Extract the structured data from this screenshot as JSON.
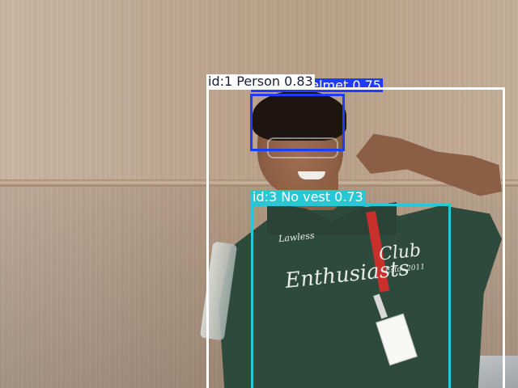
{
  "detections": [
    {
      "id": 1,
      "label": "Person",
      "confidence": "0.83",
      "text": "id:1 Person 0.83",
      "color": "#ffffff",
      "text_color": "#1c1c3a"
    },
    {
      "id": 2,
      "label": "No helmet",
      "confidence": "0.75",
      "text": "id:2 No helmet 0.75",
      "color": "#1e3cff",
      "text_color": "#ffffff"
    },
    {
      "id": 3,
      "label": "No vest",
      "confidence": "0.73",
      "text": "id:3 No vest 0.73",
      "color": "#27c7d6",
      "text_color": "#ffffff"
    }
  ],
  "shirt_print": {
    "line1": "Lawless",
    "line2": "Enthusiasts",
    "line3": "Club",
    "line4": "Estd. 2011"
  }
}
